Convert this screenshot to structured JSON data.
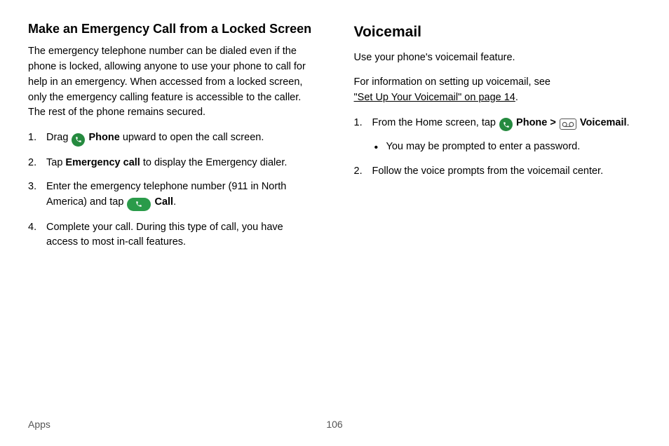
{
  "left": {
    "heading": "Make an Emergency Call from a Locked Screen",
    "intro": "The emergency telephone number can be dialed even if the phone is locked, allowing anyone to use your phone to call for help in an emergency. When accessed from a locked screen, only the emergency calling feature is accessible to the caller. The rest of the phone remains secured.",
    "steps": {
      "s1_pre": "Drag ",
      "s1_bold": "Phone",
      "s1_post": " upward to open the call screen.",
      "s2_pre": "Tap ",
      "s2_bold": "Emergency call",
      "s2_post": " to display the Emergency dialer.",
      "s3_pre": "Enter the emergency telephone number (911 in North America) and tap ",
      "s3_bold": "Call",
      "s3_post": ".",
      "s4": "Complete your call. During this type of call, you have access to most in-call features."
    }
  },
  "right": {
    "heading": "Voicemail",
    "p1": "Use your phone's voicemail feature.",
    "p2_pre": "For information on setting up voicemail, see ",
    "p2_link": "\"Set Up Your Voicemail\" on page 14",
    "p2_post": ".",
    "steps": {
      "s1_pre": "From the Home screen, tap ",
      "s1_bold_phone": "Phone",
      "s1_chevron": " > ",
      "s1_bold_vm": "Voicemail",
      "s1_post": ".",
      "s1_bullet": "You may be prompted to enter a password.",
      "s2": "Follow the voice prompts from the voicemail center."
    }
  },
  "footer": {
    "section": "Apps",
    "page": "106"
  }
}
